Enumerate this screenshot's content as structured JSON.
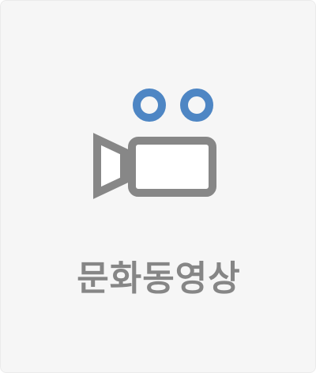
{
  "tile": {
    "label": "문화동영상",
    "icon": "video-camera-icon"
  },
  "colors": {
    "background": "#f6f6f6",
    "icon_gray": "#878787",
    "reel_blue": "#4e86c4",
    "label_gray": "#868686"
  }
}
